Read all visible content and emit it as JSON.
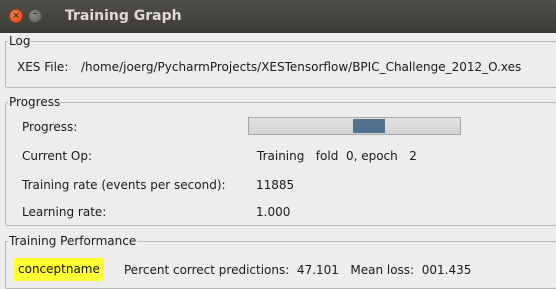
{
  "window": {
    "title": "Training Graph",
    "close_glyph": "×",
    "minimize_glyph": "–"
  },
  "log": {
    "legend": "Log",
    "xes_label": "XES File:",
    "xes_path": "/home/joerg/PycharmProjects/XESTensorflow/BPIC_Challenge_2012_O.xes"
  },
  "progress": {
    "legend": "Progress",
    "progress_label": "Progress:",
    "progress_value": 0.58,
    "current_op_label": "Current Op:",
    "current_op_value": "Training   fold  0, epoch   2",
    "training_rate_label": "Training rate (events per second):",
    "training_rate_value": "11885",
    "learning_rate_label": "Learning rate:",
    "learning_rate_value": "1.000"
  },
  "performance": {
    "legend": "Training Performance",
    "badge": "conceptname",
    "badge_color": "#ffff33",
    "text": "Percent correct predictions:  47.101   Mean loss:  001.435"
  },
  "colors": {
    "titlebar": "#3b3a36",
    "close_button": "#e4531d",
    "progress_chunk": "#516f8f"
  }
}
